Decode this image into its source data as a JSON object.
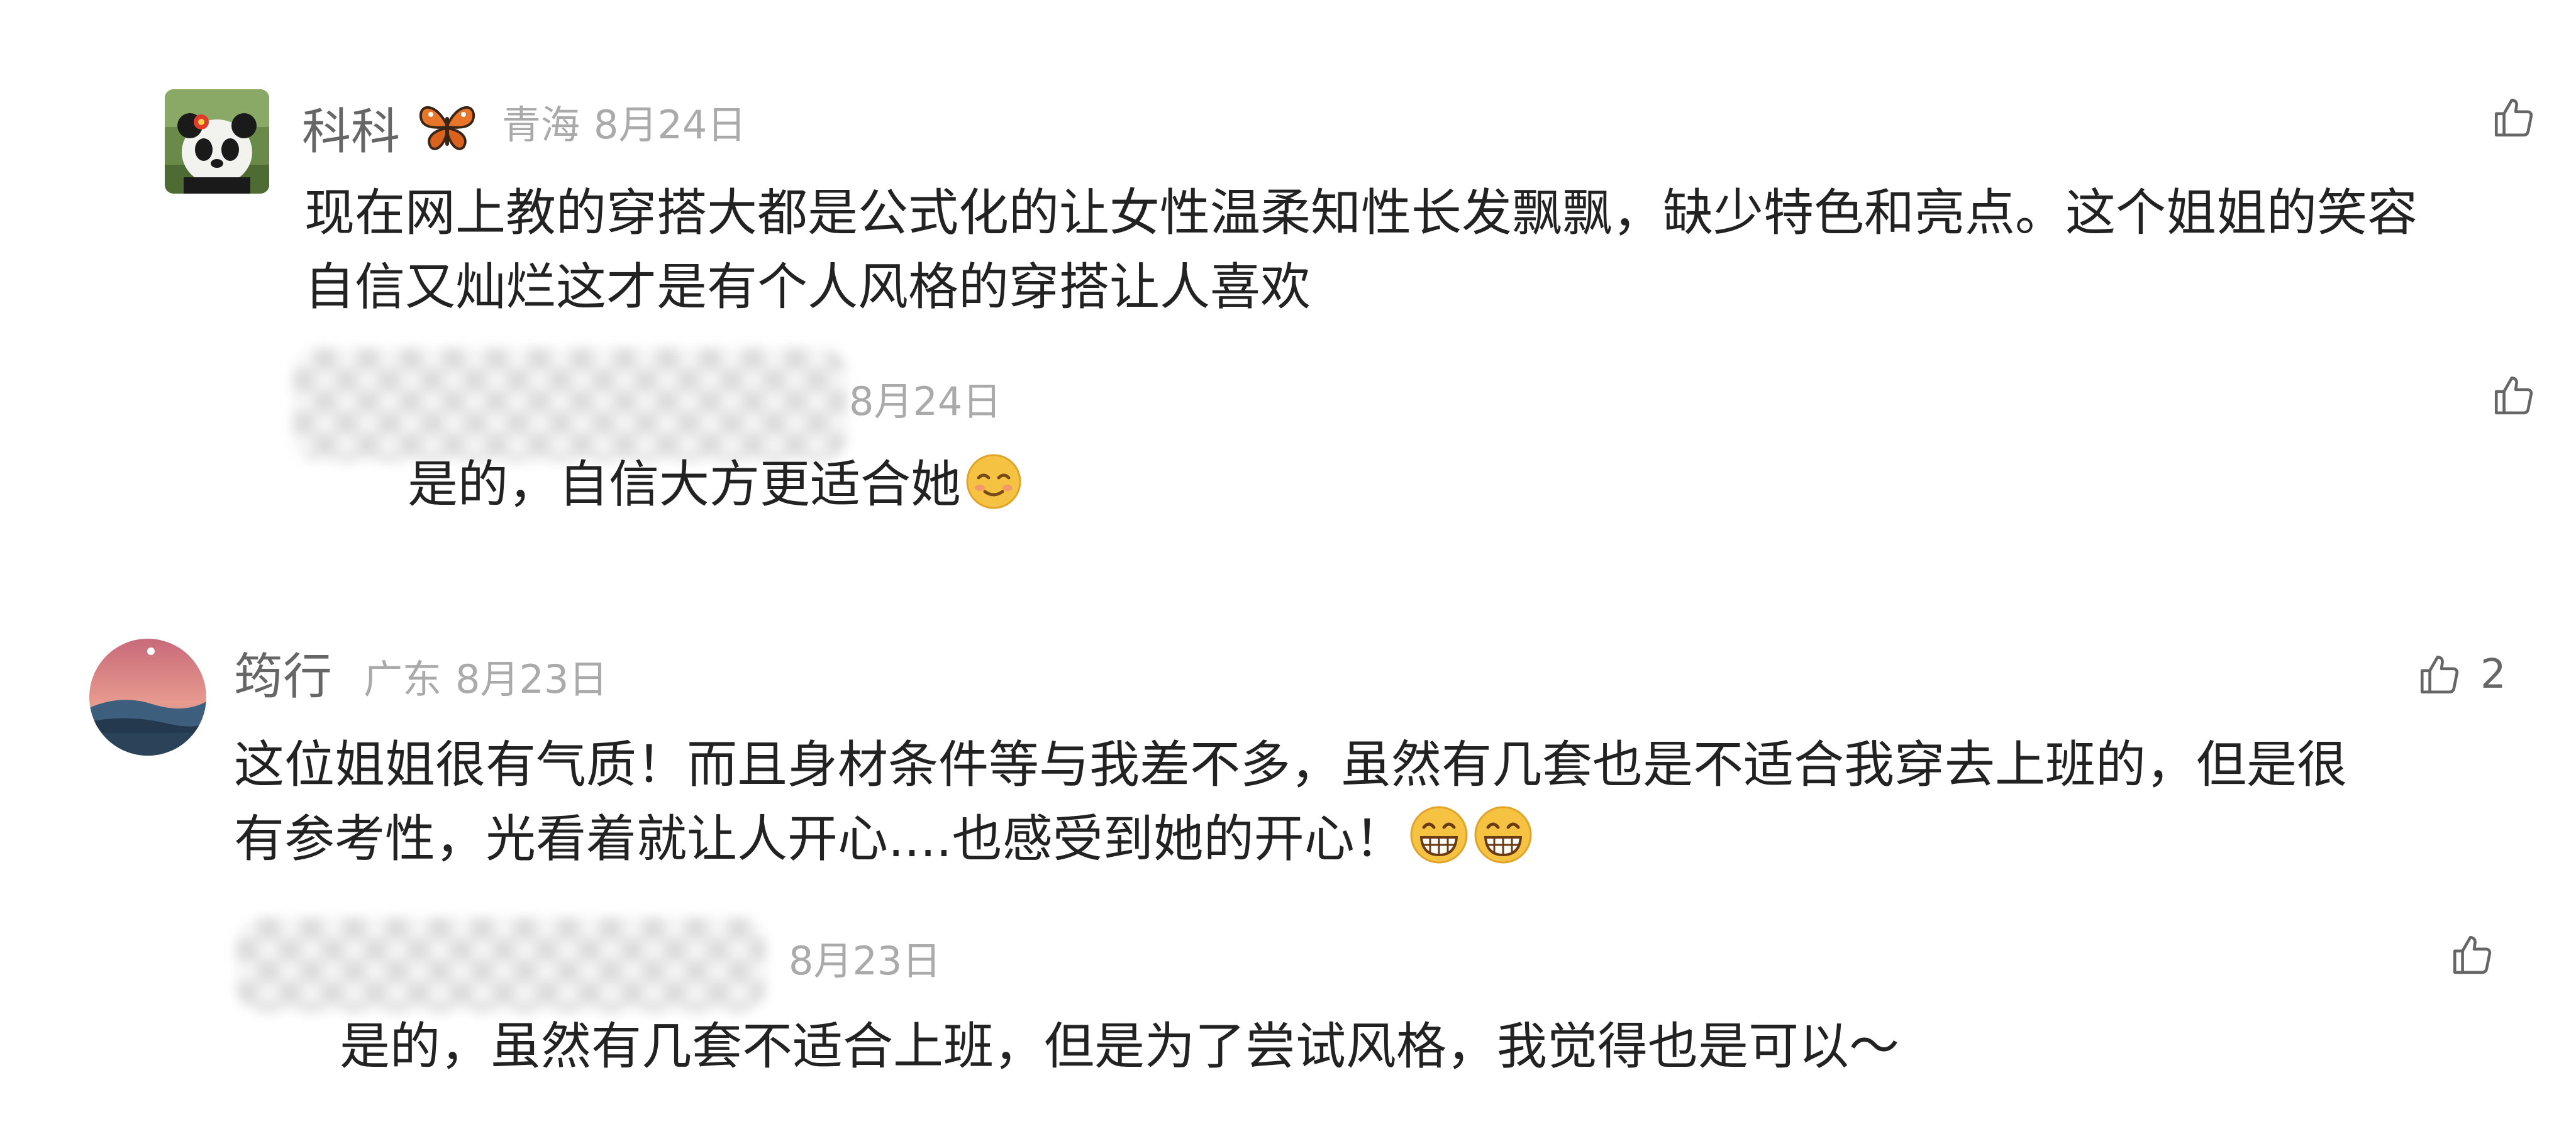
{
  "comments": [
    {
      "username": "科科",
      "username_badge_icon": "butterfly-icon",
      "location": "青海",
      "date": "8月24日",
      "text_line1": "现在网上教的穿搭大都是公式化的让女性温柔知性长发飘飘，缺少特色和亮点。这个姐姐的笑容",
      "text_line2": "自信又灿烂这才是有个人风格的穿搭让人喜欢",
      "like_count": "",
      "reply": {
        "date": "8月24日",
        "text": "是的，自信大方更适合她",
        "emoji": "relieved-face-emoji",
        "like_count": ""
      }
    },
    {
      "username": "筠行",
      "location": "广东",
      "date": "8月23日",
      "text_line1": "这位姐姐很有气质！而且身材条件等与我差不多，虽然有几套也是不适合我穿去上班的，但是很",
      "text_line2": "有参考性，光看着就让人开心....也感受到她的开心！",
      "emojis": [
        "grinning-face-emoji",
        "grinning-face-emoji"
      ],
      "like_count": "2",
      "reply": {
        "date": "8月23日",
        "text": "是的，虽然有几套不适合上班，但是为了尝试风格，我觉得也是可以～",
        "like_count": ""
      }
    }
  ],
  "icons": {
    "like": "thumbs-up-icon"
  },
  "colors": {
    "name": "#666666",
    "meta": "#aaaaaa",
    "body": "#222222",
    "background": "#ffffff"
  }
}
